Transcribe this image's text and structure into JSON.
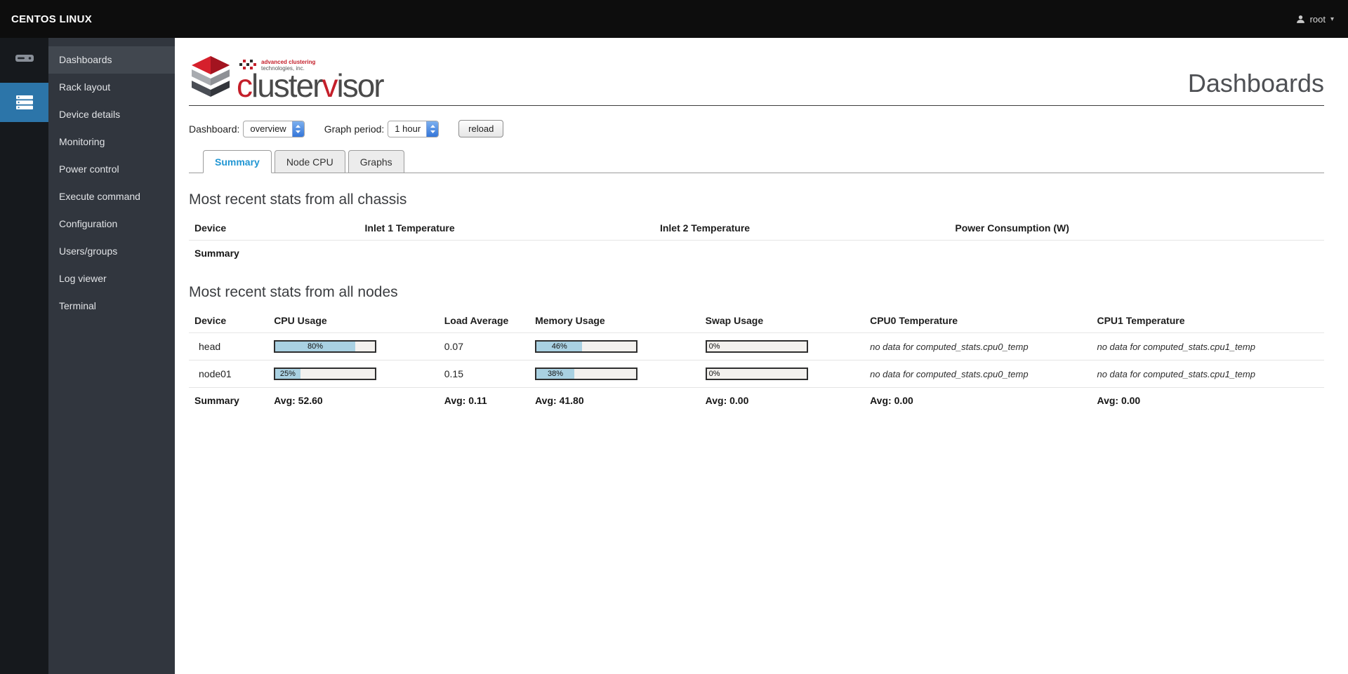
{
  "topbar": {
    "brand": "CENTOS LINUX",
    "user": "root"
  },
  "sidebar": {
    "items": [
      {
        "label": "Dashboards"
      },
      {
        "label": "Rack layout"
      },
      {
        "label": "Device details"
      },
      {
        "label": "Monitoring"
      },
      {
        "label": "Power control"
      },
      {
        "label": "Execute command"
      },
      {
        "label": "Configuration"
      },
      {
        "label": "Users/groups"
      },
      {
        "label": "Log viewer"
      },
      {
        "label": "Terminal"
      }
    ]
  },
  "logo": {
    "part1": "c",
    "part2": "luster",
    "part3": "v",
    "part4": "isor",
    "tagline1": "advanced clustering",
    "tagline2": "technologies, inc."
  },
  "header": {
    "page_title": "Dashboards"
  },
  "controls": {
    "dashboard_label": "Dashboard:",
    "dashboard_value": "overview",
    "graph_period_label": "Graph period:",
    "graph_period_value": "1 hour",
    "reload_label": "reload"
  },
  "tabs": [
    {
      "label": "Summary"
    },
    {
      "label": "Node CPU"
    },
    {
      "label": "Graphs"
    }
  ],
  "chassis": {
    "title": "Most recent stats from all chassis",
    "columns": [
      "Device",
      "Inlet 1 Temperature",
      "Inlet 2 Temperature",
      "Power Consumption (W)"
    ],
    "summary": {
      "device": "Summary"
    }
  },
  "nodes": {
    "title": "Most recent stats from all nodes",
    "columns": [
      "Device",
      "CPU Usage",
      "Load Average",
      "Memory Usage",
      "Swap Usage",
      "CPU0 Temperature",
      "CPU1 Temperature"
    ],
    "rows": [
      {
        "device": "head",
        "cpu_pct": 80,
        "cpu_label": "80%",
        "load": "0.07",
        "mem_pct": 46,
        "mem_label": "46%",
        "swap_pct": 0,
        "swap_label": "0%",
        "cpu0": "no data for computed_stats.cpu0_temp",
        "cpu1": "no data for computed_stats.cpu1_temp"
      },
      {
        "device": "node01",
        "cpu_pct": 25,
        "cpu_label": "25%",
        "load": "0.15",
        "mem_pct": 38,
        "mem_label": "38%",
        "swap_pct": 0,
        "swap_label": "0%",
        "cpu0": "no data for computed_stats.cpu0_temp",
        "cpu1": "no data for computed_stats.cpu1_temp"
      }
    ],
    "summary": {
      "device": "Summary",
      "cpu": "Avg: 52.60",
      "load": "Avg: 0.11",
      "mem": "Avg: 41.80",
      "swap": "Avg: 0.00",
      "cpu0": "Avg: 0.00",
      "cpu1": "Avg: 0.00"
    }
  }
}
